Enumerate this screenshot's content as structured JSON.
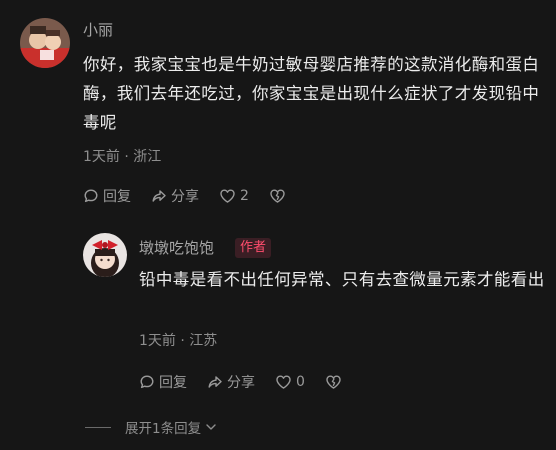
{
  "comment": {
    "author": "小丽",
    "text": "你好，我家宝宝也是牛奶过敏母婴店推荐的这款消化酶和蛋白酶，我们去年还吃过，你家宝宝是出现什么症状了才发现铅中毒呢",
    "meta": "1天前 · 浙江",
    "reply_label": "回复",
    "share_label": "分享",
    "like_count": "2"
  },
  "reply": {
    "author": "墩墩吃饱饱",
    "author_badge": "作者",
    "text": "铅中毒是看不出任何异常、只有去查微量元素才能看出",
    "meta": "1天前 · 江苏",
    "reply_label": "回复",
    "share_label": "分享",
    "like_count": "0"
  },
  "expand_replies": {
    "label": "展开1条回复"
  },
  "colors": {
    "background": "#161616",
    "badge_text": "#ff4d6d",
    "badge_bg": "#3a1e24"
  },
  "icons": {
    "reply": "comment-bubble-icon",
    "share": "share-arrow-icon",
    "like": "heart-icon",
    "dislike": "broken-heart-icon",
    "expand": "chevron-down-icon"
  }
}
